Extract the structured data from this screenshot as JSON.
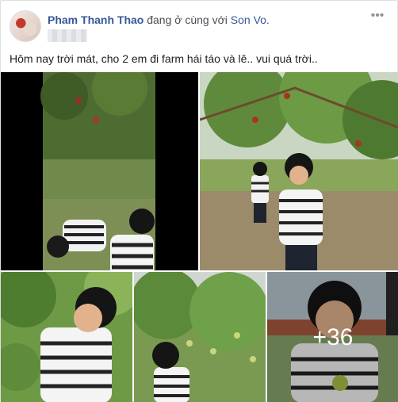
{
  "post": {
    "author": "Pham Thanh Thao",
    "with_text": "đang ở cùng với",
    "tagged_user": "Son Vo.",
    "caption": "Hôm nay trời mát, cho 2 em đi farm hái táo và lê.. vui quá trời..",
    "more_icon": "ellipsis-icon"
  },
  "photos": {
    "more_count": "+36"
  }
}
